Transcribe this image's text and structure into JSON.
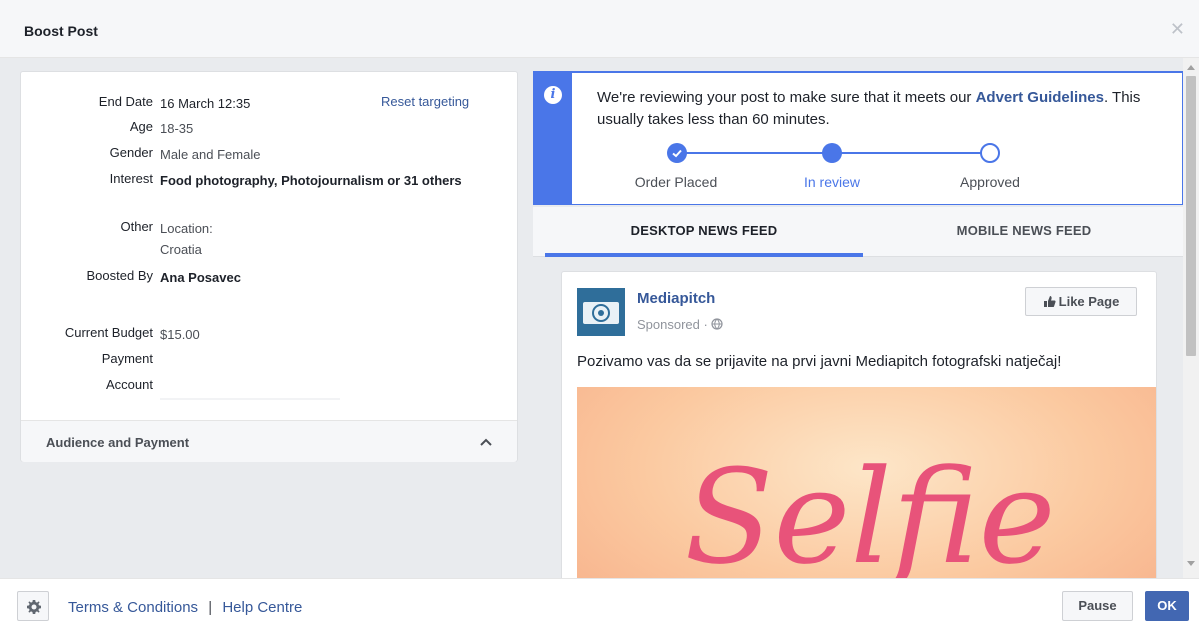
{
  "dialog": {
    "title": "Boost Post",
    "close_icon": "close-icon"
  },
  "summary": {
    "reset_link": "Reset targeting",
    "rows": [
      {
        "label": "End Date",
        "value": "16 March 12:35"
      },
      {
        "label": "Age",
        "value": "18-35"
      },
      {
        "label": "Gender",
        "value": "Male and Female"
      },
      {
        "label": "Interest",
        "value": "Food photography, Photojournalism or 31 others"
      },
      {
        "label": "Other",
        "value": "Location:",
        "value2": "Croatia"
      },
      {
        "label": "Boosted By",
        "value": "Ana Posavec"
      },
      {
        "label": "Current Budget",
        "value": "$15.00"
      },
      {
        "label": "Payment",
        "value": ""
      },
      {
        "label": "Account",
        "value": ""
      }
    ],
    "section_label": "Audience and Payment"
  },
  "review": {
    "message_pre": "We're reviewing your post to make sure that it meets our ",
    "message_link": "Advert Guidelines",
    "message_post": ". This usually takes less than 60 minutes.",
    "steps": [
      {
        "label": "Order Placed",
        "state": "done"
      },
      {
        "label": "In review",
        "state": "current"
      },
      {
        "label": "Approved",
        "state": "todo"
      }
    ],
    "accent": "#4a76e8"
  },
  "tabs": [
    {
      "label": "DESKTOP NEWS FEED",
      "active": true
    },
    {
      "label": "MOBILE NEWS FEED",
      "active": false
    }
  ],
  "post": {
    "page_name": "Mediapitch",
    "sponsored": "Sponsored · ",
    "like_button": "Like Page",
    "text": "Pozivamo vas da se prijavite na prvi javni Mediapitch fotografski natječaj!",
    "image_text": "Selfie"
  },
  "footer": {
    "terms": "Terms & Conditions",
    "separator": "|",
    "help": "Help Centre",
    "pause": "Pause",
    "ok": "OK"
  }
}
